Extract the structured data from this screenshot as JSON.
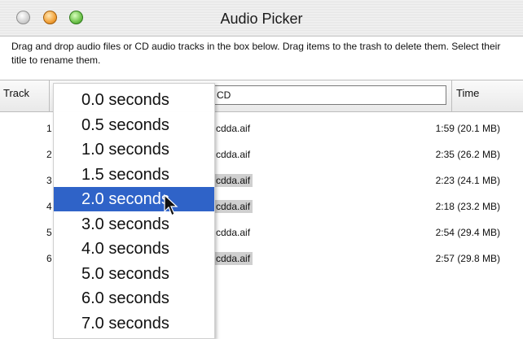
{
  "window": {
    "title": "Audio Picker"
  },
  "instructions": "Drag and drop audio files or CD audio tracks in the box below. Drag items to the trash to delete them. Select their title to rename them.",
  "header": {
    "track": "Track",
    "title_value": "CD",
    "time": "Time"
  },
  "rows": [
    {
      "num": "1",
      "name": "cdda.aif",
      "time": "1:59 (20.1 MB)",
      "selected": false
    },
    {
      "num": "2",
      "name": "cdda.aif",
      "time": "2:35 (26.2 MB)",
      "selected": false
    },
    {
      "num": "3",
      "name": "cdda.aif",
      "time": "2:23 (24.1 MB)",
      "selected": true
    },
    {
      "num": "4",
      "name": "cdda.aif",
      "time": "2:18 (23.2 MB)",
      "selected": true
    },
    {
      "num": "5",
      "name": "cdda.aif",
      "time": "2:54 (29.4 MB)",
      "selected": false
    },
    {
      "num": "6",
      "name": "cdda.aif",
      "time": "2:57 (29.8 MB)",
      "selected": true
    }
  ],
  "popup": {
    "items": [
      "0.0 seconds",
      "0.5 seconds",
      "1.0 seconds",
      "1.5 seconds",
      "2.0 seconds",
      "3.0 seconds",
      "4.0 seconds",
      "5.0 seconds",
      "6.0 seconds",
      "7.0 seconds"
    ],
    "selected": "2.0 seconds"
  }
}
